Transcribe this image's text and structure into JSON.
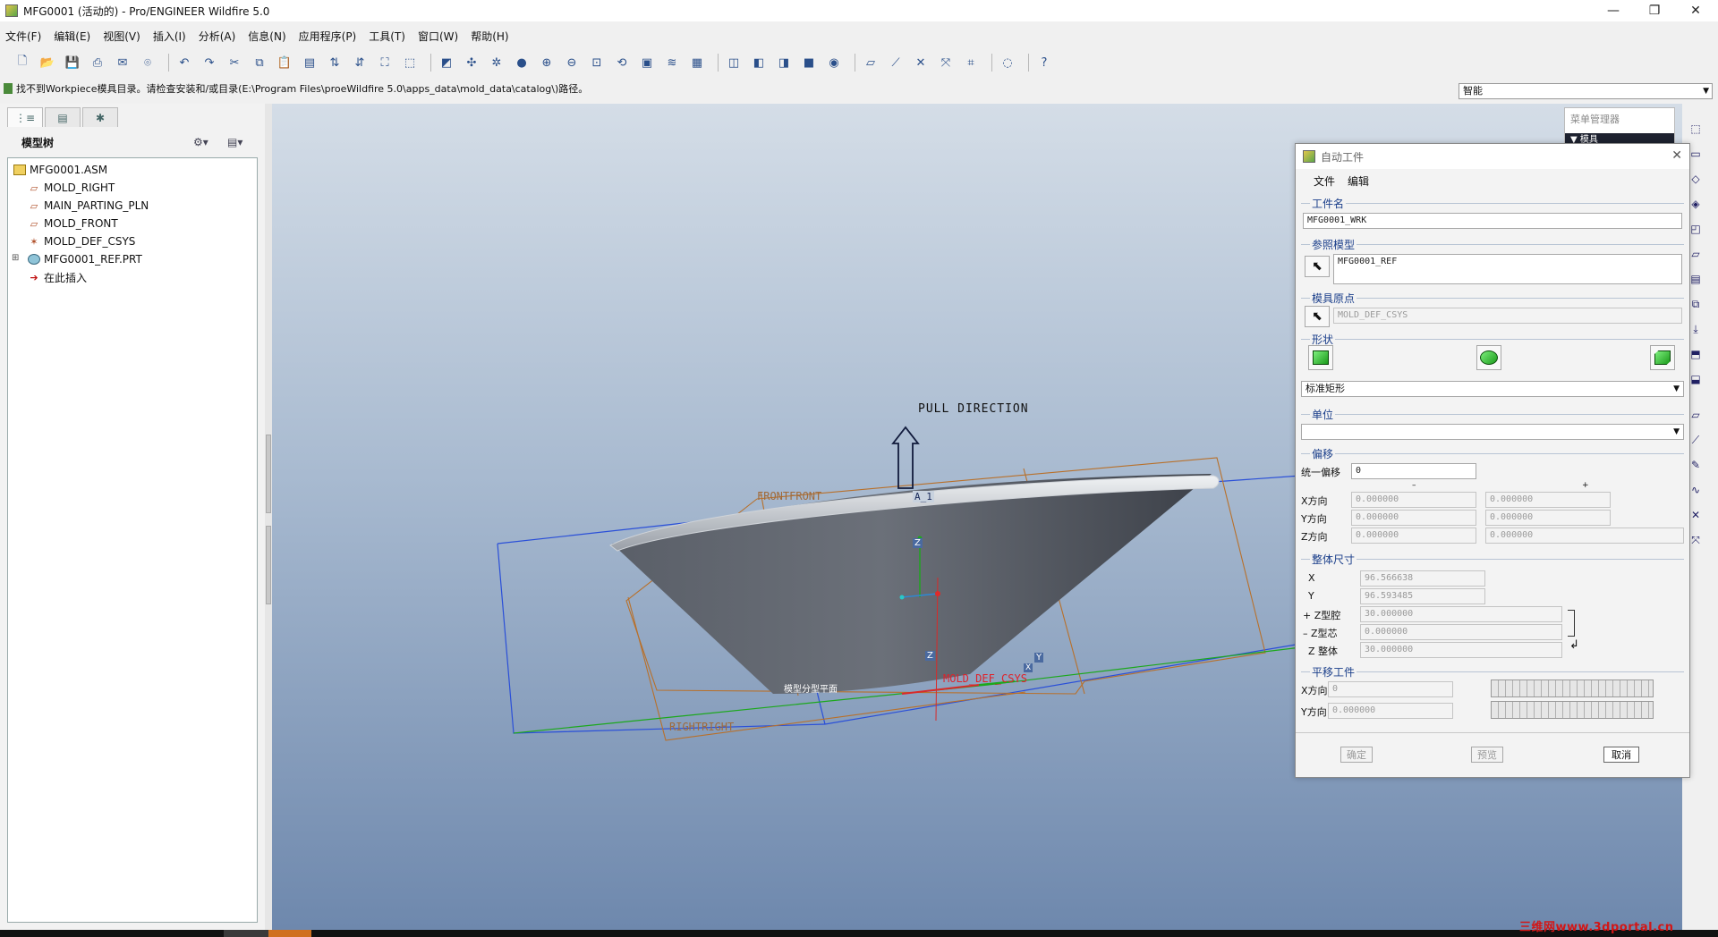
{
  "window": {
    "title": "MFG0001 (活动的) - Pro/ENGINEER Wildfire 5.0",
    "minimize": "—",
    "maximize": "❐",
    "close": "✕"
  },
  "menus": [
    "文件(F)",
    "编辑(E)",
    "视图(V)",
    "插入(I)",
    "分析(A)",
    "信息(N)",
    "应用程序(P)",
    "工具(T)",
    "窗口(W)",
    "帮助(H)"
  ],
  "message": "找不到Workpiece模具目录。请检查安装和/或目录(E:\\Program Files\\proeWildfire 5.0\\apps_data\\mold_data\\catalog\\)路径。",
  "filter_select": "智能",
  "model_tree": {
    "header": "模型树",
    "items": [
      {
        "label": "MFG0001.ASM",
        "icon": "assembly-icon"
      },
      {
        "label": "MOLD_RIGHT",
        "icon": "datum-plane-icon"
      },
      {
        "label": "MAIN_PARTING_PLN",
        "icon": "datum-plane-icon"
      },
      {
        "label": "MOLD_FRONT",
        "icon": "datum-plane-icon"
      },
      {
        "label": "MOLD_DEF_CSYS",
        "icon": "csys-icon"
      },
      {
        "label": "MFG0001_REF.PRT",
        "icon": "part-icon"
      },
      {
        "label": "在此插入",
        "icon": "insert-arrow-icon"
      }
    ]
  },
  "viewport": {
    "pull_direction": "PULL DIRECTION",
    "front_label": "FRONTFRONT",
    "right_label": "RIGHTRIGHT",
    "a1_label": "A_1",
    "csys_label": "MOLD_DEF_CSYS",
    "parting_label": "模型分型平面",
    "z_axis": "Z",
    "y_axis": "Y",
    "x_axis": "X"
  },
  "menu_manager": {
    "title": "菜单管理器",
    "bar": "▼ 模具"
  },
  "dialog": {
    "title": "自动工件",
    "menu": [
      "文件",
      "编辑"
    ],
    "workpiece_name": {
      "label": "工件名",
      "value": "MFG0001_WRK"
    },
    "ref_model": {
      "label": "参照模型",
      "value": "MFG0001_REF"
    },
    "mold_origin": {
      "label": "模具原点",
      "value": "MOLD_DEF_CSYS"
    },
    "shape": {
      "label": "形状",
      "selected": "标准矩形"
    },
    "units": {
      "label": "单位",
      "selected": ""
    },
    "offset": {
      "label": "偏移",
      "uniform_label": "统一偏移",
      "uniform_value": "0",
      "minus": "–",
      "plus": "+",
      "rows": [
        {
          "label": "X方向",
          "neg": "0.000000",
          "pos": "0.000000"
        },
        {
          "label": "Y方向",
          "neg": "0.000000",
          "pos": "0.000000"
        },
        {
          "label": "Z方向",
          "neg": "0.000000",
          "pos": "0.000000"
        }
      ]
    },
    "overall": {
      "label": "整体尺寸",
      "x_label": "X",
      "x_value": "96.566638",
      "y_label": "Y",
      "y_value": "96.593485",
      "zcav_label": "+ Z型腔",
      "zcav_value": "30.000000",
      "zcore_label": "– Z型芯",
      "zcore_value": "0.000000",
      "ztot_label": "Z 整体",
      "ztot_value": "30.000000"
    },
    "translate": {
      "label": "平移工件",
      "x_label": "X方向",
      "x_value": "0",
      "y_label": "Y方向",
      "y_value": "0.000000"
    },
    "buttons": {
      "ok": "确定",
      "preview": "预览",
      "cancel": "取消"
    }
  },
  "watermark": "三维网www.3dportal.cn"
}
